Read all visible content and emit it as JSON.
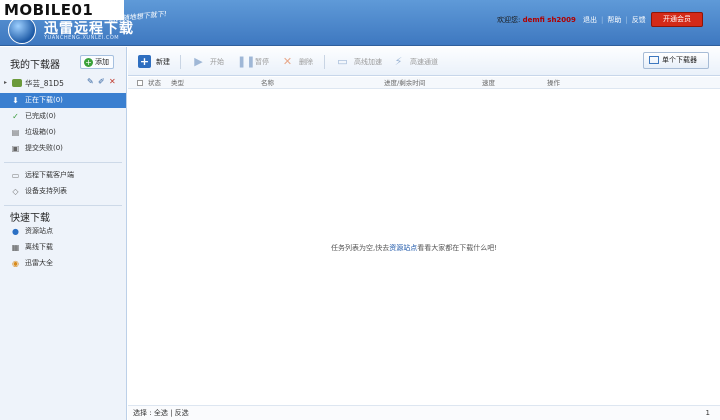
{
  "header": {
    "badge_text": "MOBILE01",
    "app_title": "迅雷远程下载",
    "app_domain": "YUANCHENG.XUNLEI.COM",
    "slogan": "随时随地想下就下!",
    "welcome_label": "欢迎您:",
    "username": "demfi sh2009",
    "links": [
      "退出",
      "帮助",
      "反馈"
    ],
    "vip_button": "开通会员"
  },
  "sidebar": {
    "title": "我的下载器",
    "add_label": "添加",
    "device_name": "华芸_81D5",
    "items": [
      {
        "label": "正在下载(0)",
        "icon": "download-arrow-icon",
        "active": true
      },
      {
        "label": "已完成(0)",
        "icon": "check-icon",
        "active": false
      },
      {
        "label": "垃圾箱(0)",
        "icon": "trash-icon",
        "active": false
      },
      {
        "label": "提交失败(0)",
        "icon": "failed-icon",
        "active": false
      }
    ],
    "tools": [
      {
        "label": "远程下载客户端",
        "icon": "client-icon"
      },
      {
        "label": "设备支持列表",
        "icon": "device-list-icon"
      }
    ],
    "quick_title": "快速下载",
    "quick": [
      {
        "label": "资源站点",
        "icon": "globe-icon"
      },
      {
        "label": "离线下载",
        "icon": "offline-icon"
      },
      {
        "label": "迅雷大全",
        "icon": "xunlei-icon"
      }
    ]
  },
  "toolbar": {
    "new_label": "新建",
    "start_label": "开始",
    "pause_label": "暂停",
    "delete_label": "删除",
    "hd_label": "高线加速",
    "fast_label": "高速通道",
    "single_label": "单个下载器"
  },
  "table": {
    "columns": [
      "状态",
      "类型",
      "名称",
      "进度/剩余时间",
      "速度",
      "操作"
    ]
  },
  "empty": {
    "prefix": "任务列表为空,快去",
    "link": "资源站点",
    "suffix": "看看大家都在下载什么吧!"
  },
  "footer": {
    "select_label": "选择 :",
    "all": "全选",
    "sep": "|",
    "invert": "反选",
    "page": "1"
  },
  "colors": {
    "header_blue": "#4b86cc",
    "active_item": "#3a7fd0",
    "vip_red": "#d42a18"
  }
}
